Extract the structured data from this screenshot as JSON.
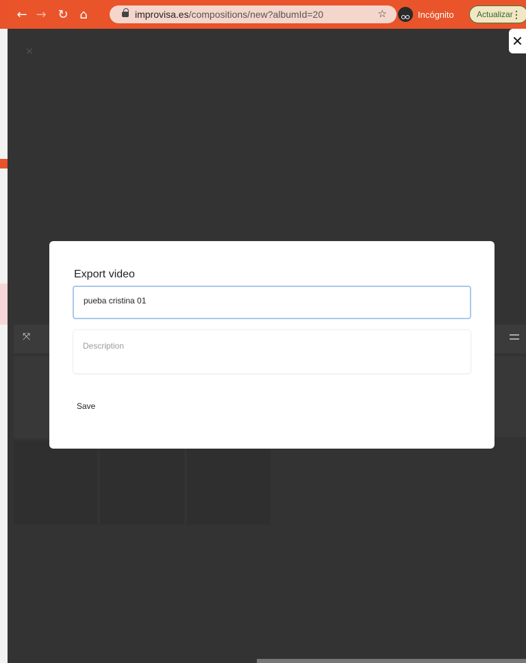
{
  "browser": {
    "back_icon": "←",
    "forward_icon": "→",
    "reload_icon": "↻",
    "home_icon": "⌂",
    "url_host": "improvisa.es",
    "url_path": "/compositions/new?albumId=20",
    "star_icon": "☆",
    "incognito_label": "Incógnito",
    "update_label": "Actualizar",
    "menu_icon": "⋮",
    "chrome_color": "#e9542b"
  },
  "app": {
    "corner_close_icon": "×",
    "panel_close_icon": "✕",
    "expand_icon": "⤧"
  },
  "modal": {
    "title": "Export video",
    "title_field_value": "pueba cristina 01",
    "description_placeholder": "Description",
    "save_label": "Save"
  }
}
